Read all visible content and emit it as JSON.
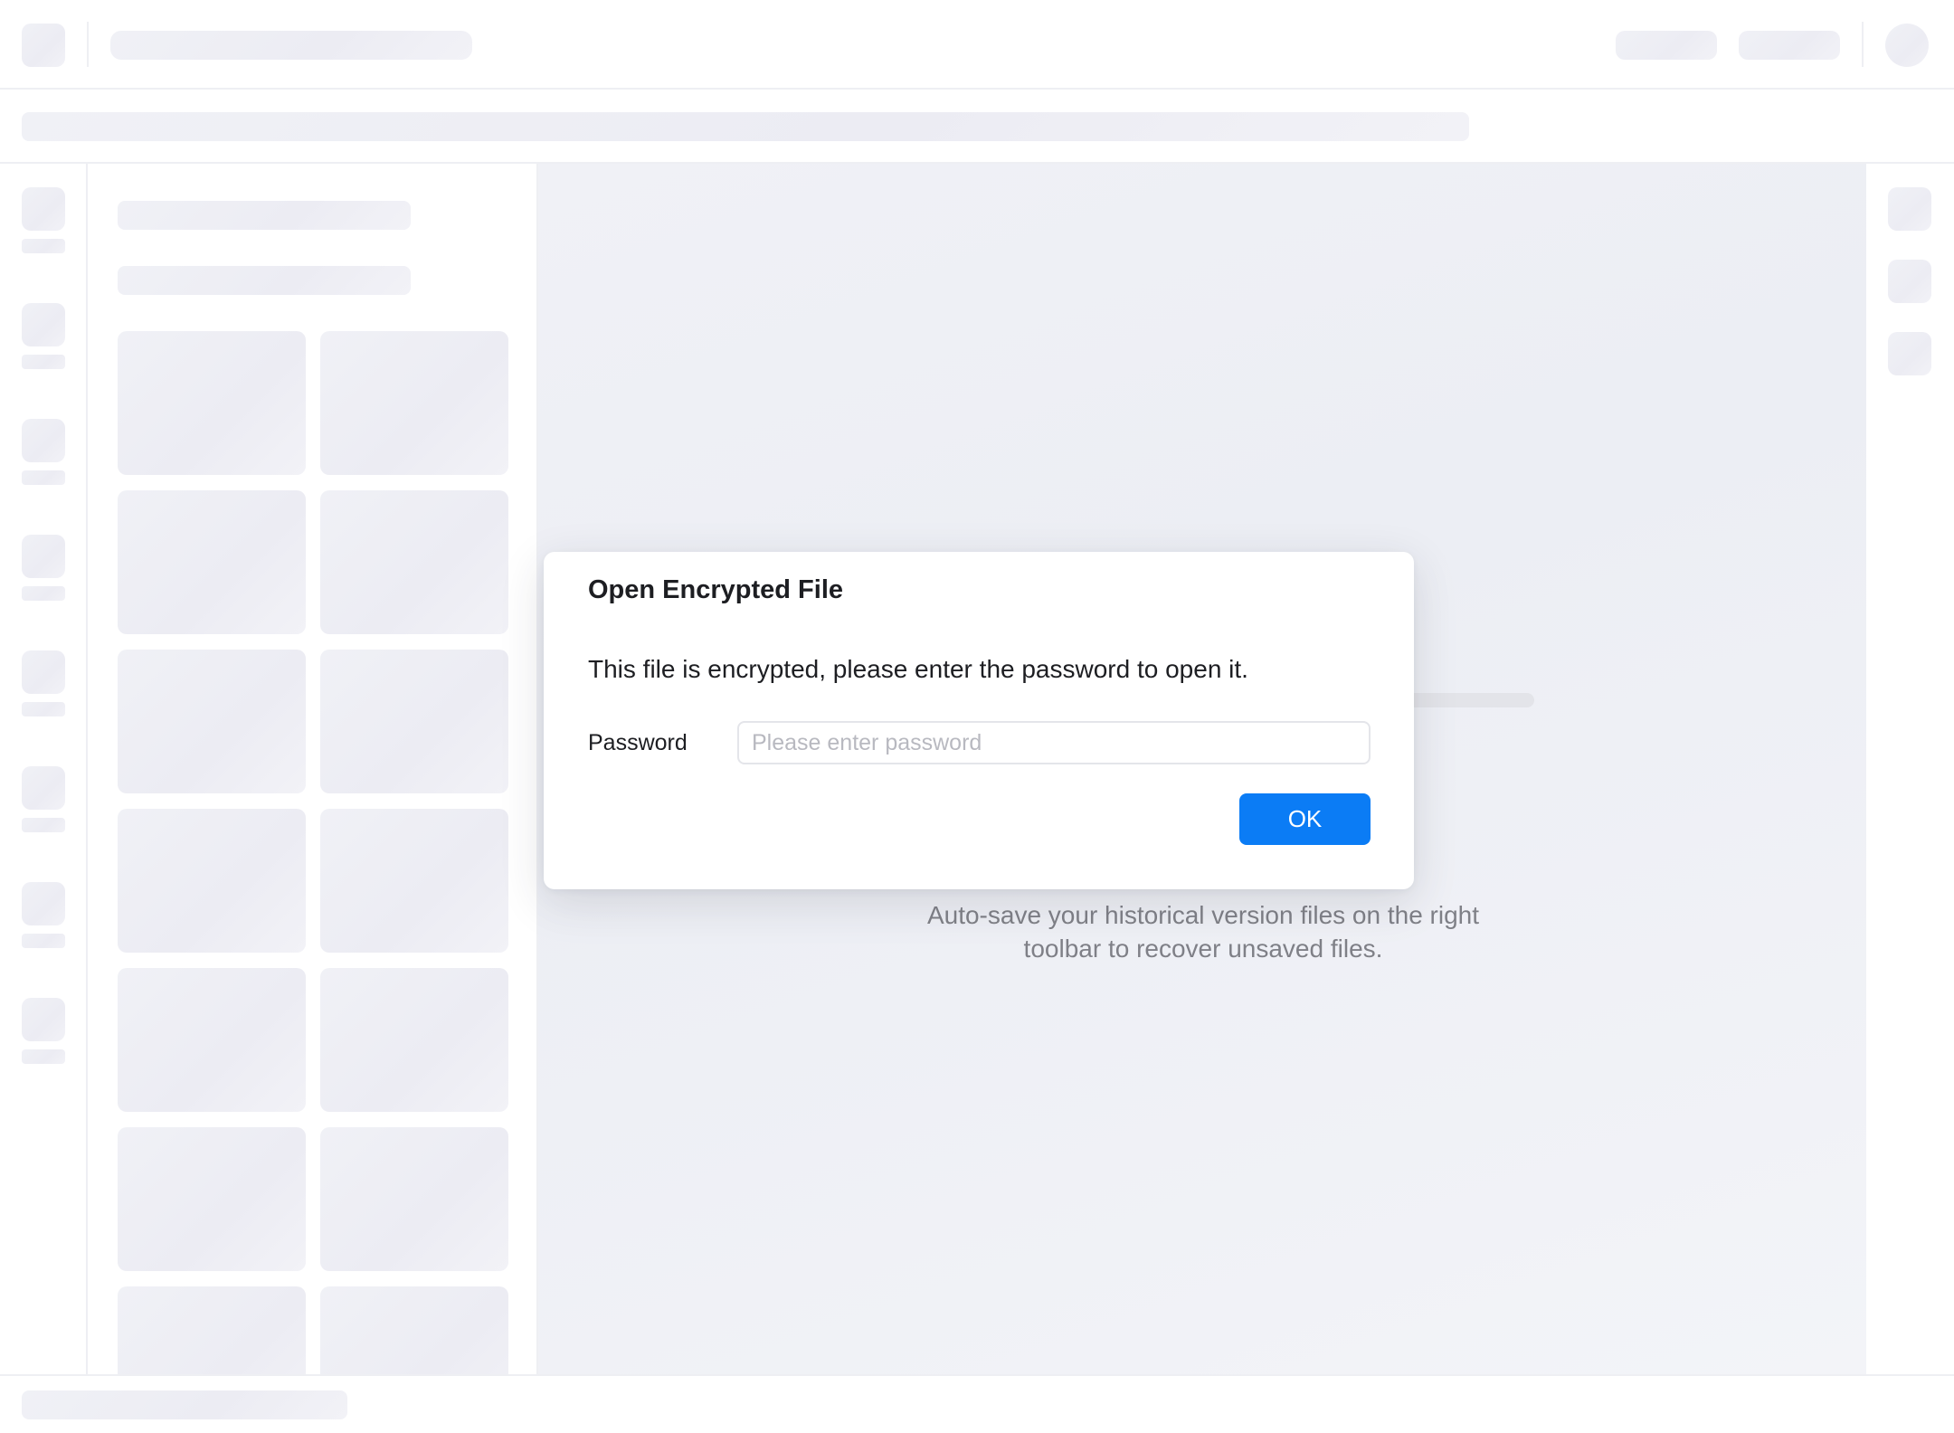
{
  "dialog": {
    "title": "Open Encrypted File",
    "message": "This file is encrypted, please enter the password to open it.",
    "password_label": "Password",
    "password_placeholder": "Please enter password",
    "password_value": "",
    "ok_label": "OK"
  },
  "canvas": {
    "hint_line_1": "Auto-save your historical version files on the right",
    "hint_line_2": "toolbar to recover unsaved files."
  },
  "colors": {
    "accent": "#0b7cf5",
    "skeleton": "#eeeff4",
    "canvas_bg": "#eff0f5"
  }
}
